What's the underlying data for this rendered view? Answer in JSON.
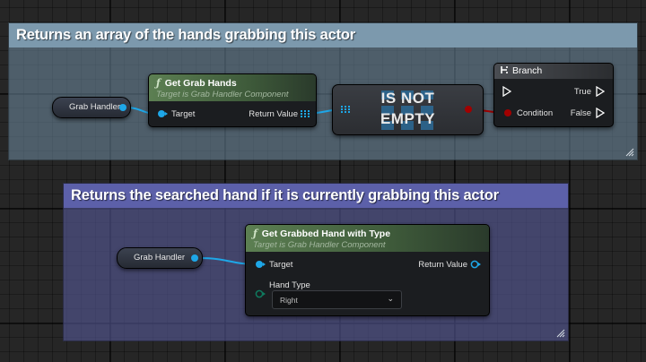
{
  "comments": {
    "top": {
      "title": "Returns an array of the hands grabbing this actor"
    },
    "bottom": {
      "title": "Returns the searched hand if it is currently grabbing this actor"
    }
  },
  "nodes": {
    "grab_handler_1": {
      "label": "Grab Handler"
    },
    "get_grab_hands": {
      "function_icon": "function-icon",
      "title": "Get Grab Hands",
      "subtitle": "Target is Grab Handler Component",
      "target_label": "Target",
      "return_label": "Return Value"
    },
    "is_not_empty": {
      "line1": "IS NOT",
      "line2": "EMPTY"
    },
    "branch": {
      "icon": "branch-icon",
      "title": "Branch",
      "condition_label": "Condition",
      "true_label": "True",
      "false_label": "False"
    },
    "grab_handler_2": {
      "label": "Grab Handler"
    },
    "get_grabbed_hand": {
      "function_icon": "function-icon",
      "title": "Get Grabbed Hand with Type",
      "subtitle": "Target is Grab Handler Component",
      "target_label": "Target",
      "return_label": "Return Value",
      "hand_type_label": "Hand Type",
      "hand_type_value": "Right"
    }
  },
  "colors": {
    "object_pin": "#1ea7e8",
    "bool_pin": "#a10000",
    "enum_pin": "#0f7a5e",
    "exec_pin": "#ffffff",
    "comment_top": "#7c99ad",
    "comment_bottom": "#5c60a9",
    "function_header": "#5c7f52"
  }
}
